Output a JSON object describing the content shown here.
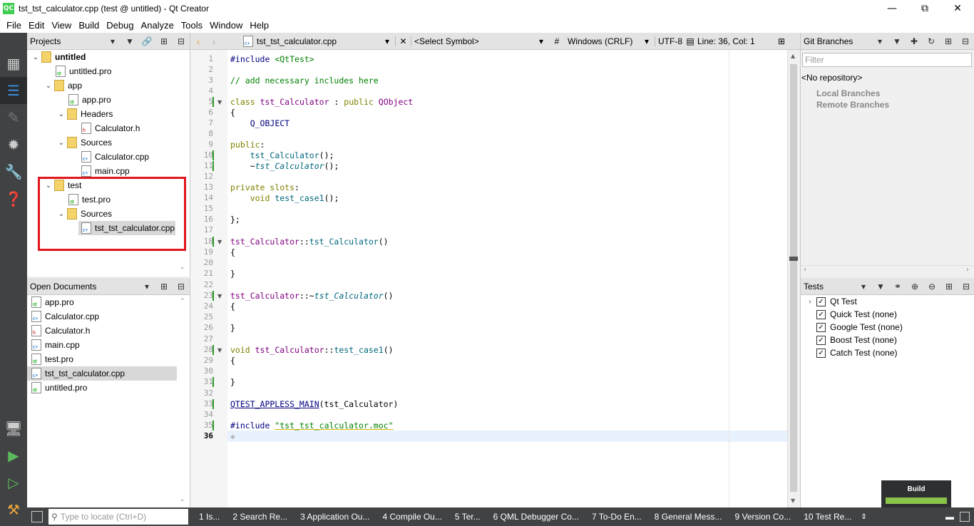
{
  "window": {
    "title": "tst_tst_calculator.cpp (test @ untitled) - Qt Creator",
    "app_icon": "QC"
  },
  "menubar": [
    "File",
    "Edit",
    "View",
    "Build",
    "Debug",
    "Analyze",
    "Tools",
    "Window",
    "Help"
  ],
  "projects": {
    "header": "Projects",
    "tree": [
      {
        "label": "untitled",
        "bold": true
      },
      {
        "label": "untitled.pro"
      },
      {
        "label": "app"
      },
      {
        "label": "app.pro"
      },
      {
        "label": "Headers"
      },
      {
        "label": "Calculator.h"
      },
      {
        "label": "Sources"
      },
      {
        "label": "Calculator.cpp"
      },
      {
        "label": "main.cpp"
      },
      {
        "label": "test"
      },
      {
        "label": "test.pro"
      },
      {
        "label": "Sources"
      },
      {
        "label": "tst_tst_calculator.cpp"
      }
    ]
  },
  "open_documents": {
    "header": "Open Documents",
    "items": [
      "app.pro",
      "Calculator.cpp",
      "Calculator.h",
      "main.cpp",
      "test.pro",
      "tst_tst_calculator.cpp",
      "untitled.pro"
    ]
  },
  "editor": {
    "file": "tst_tst_calculator.cpp",
    "symbol": "<Select Symbol>",
    "hash": "#",
    "line_endings": "Windows (CRLF)",
    "encoding": "UTF-8",
    "position": "Line: 36, Col: 1",
    "line_numbers": [
      "1",
      "2",
      "3",
      "4",
      "5",
      "6",
      "7",
      "8",
      "9",
      "10",
      "11",
      "12",
      "13",
      "14",
      "15",
      "16",
      "17",
      "18",
      "19",
      "20",
      "21",
      "22",
      "23",
      "24",
      "25",
      "26",
      "27",
      "28",
      "29",
      "30",
      "31",
      "32",
      "33",
      "34",
      "35",
      "36"
    ]
  },
  "git": {
    "header": "Git Branches",
    "filter_placeholder": "Filter",
    "no_repo": "<No repository>",
    "local": "Local Branches",
    "remote": "Remote Branches"
  },
  "tests": {
    "header": "Tests",
    "items": [
      "Qt Test",
      "Quick Test (none)",
      "Google Test (none)",
      "Boost Test (none)",
      "Catch Test (none)"
    ]
  },
  "statusbar": {
    "locator_placeholder": "Type to locate (Ctrl+D)",
    "panes": [
      "1  Is...",
      "2  Search Re...",
      "3  Application Ou...",
      "4  Compile Ou...",
      "5  Ter...",
      "6  QML Debugger Co...",
      "7  To-Do En...",
      "8  General Mess...",
      "9  Version Co...",
      "10  Test Re..."
    ]
  },
  "build_indicator": {
    "label": "Build",
    "progress_percent": 100,
    "color": "#8bc34a"
  }
}
